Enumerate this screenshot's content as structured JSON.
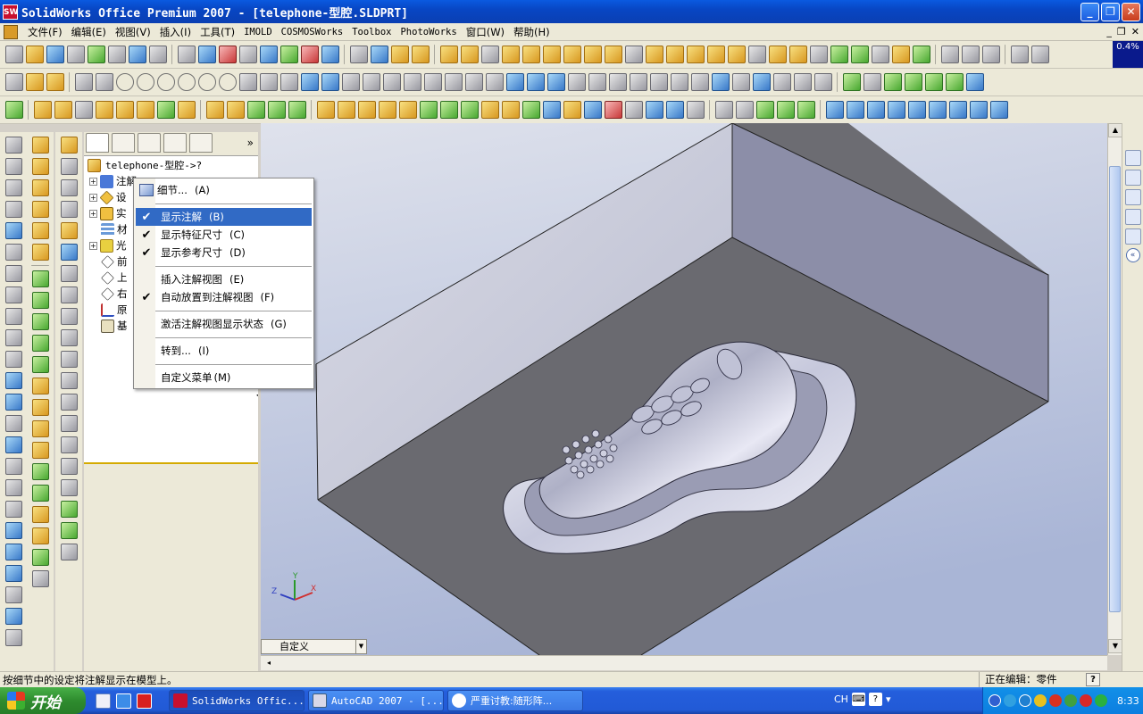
{
  "window": {
    "title": "SolidWorks Office Premium 2007 - [telephone-型腔.SLDPRT]",
    "app_icon_label": "SW",
    "buttons": [
      "_",
      "❐",
      "✕"
    ]
  },
  "menu": {
    "items": [
      "文件(F)",
      "编辑(E)",
      "视图(V)",
      "插入(I)",
      "工具(T)",
      "IMOLD",
      "COSMOSWorks",
      "Toolbox",
      "PhotoWorks",
      "窗口(W)",
      "帮助(H)"
    ],
    "mdi_buttons": [
      "_",
      "❐",
      "✕"
    ]
  },
  "zoom_indicator": "0.4%",
  "feature_manager": {
    "root_label": "telephone-型腔->?",
    "tree_items": [
      {
        "label": "注解",
        "icon": "annotations-icon",
        "expandable": true
      },
      {
        "label": "设",
        "icon": "design-binder-icon",
        "expandable": true
      },
      {
        "label": "实",
        "icon": "solid-bodies-icon",
        "expandable": true
      },
      {
        "label": "材",
        "icon": "material-icon",
        "expandable": false
      },
      {
        "label": "光",
        "icon": "lights-icon",
        "expandable": true
      },
      {
        "label": "前",
        "icon": "plane-icon",
        "expandable": false
      },
      {
        "label": "上",
        "icon": "plane-icon",
        "expandable": false
      },
      {
        "label": "右",
        "icon": "plane-icon",
        "expandable": false
      },
      {
        "label": "原",
        "icon": "origin-icon",
        "expandable": false
      },
      {
        "label": "基",
        "icon": "base-feature-icon",
        "expandable": false
      }
    ]
  },
  "context_menu": {
    "items": [
      {
        "label": "细节...",
        "shortcut": "(A)",
        "checked": false,
        "icon": "details-icon"
      },
      {
        "label": "显示注解",
        "shortcut": "(B)",
        "checked": true,
        "highlighted": true
      },
      {
        "label": "显示特征尺寸",
        "shortcut": "(C)",
        "checked": true
      },
      {
        "label": "显示参考尺寸",
        "shortcut": "(D)",
        "checked": true
      },
      {
        "label": "插入注解视图",
        "shortcut": "(E)",
        "checked": false
      },
      {
        "label": "自动放置到注解视图",
        "shortcut": "(F)",
        "checked": true
      },
      {
        "label": "激活注解视图显示状态",
        "shortcut": "(G)",
        "checked": false
      },
      {
        "label": "转到...",
        "shortcut": "(I)",
        "checked": false
      },
      {
        "label": "自定义菜单",
        "shortcut": "(M)",
        "checked": false
      }
    ]
  },
  "configuration_select": {
    "value": "自定义"
  },
  "triad": {
    "x": "X",
    "y": "Y",
    "z": "Z"
  },
  "status": {
    "message": "按细节中的设定将注解显示在模型上。",
    "mode": "正在编辑：零件",
    "help": "?"
  },
  "taskbar": {
    "start": "开始",
    "tasks": [
      {
        "label": "SolidWorks Offic...",
        "active": true
      },
      {
        "label": "AutoCAD 2007 - [...",
        "active": false
      },
      {
        "label": "严重讨教:随形阵...",
        "active": false
      }
    ],
    "ime": "CH",
    "clock": "8:33"
  },
  "colors": {
    "accent": "#316ac5",
    "title_bar": "#0846c4",
    "viewport_bg_top": "#d8dce8",
    "viewport_bg_bottom": "#a8b4d4",
    "mold_top": "#6e6e74",
    "mold_side": "#c8cad8"
  }
}
